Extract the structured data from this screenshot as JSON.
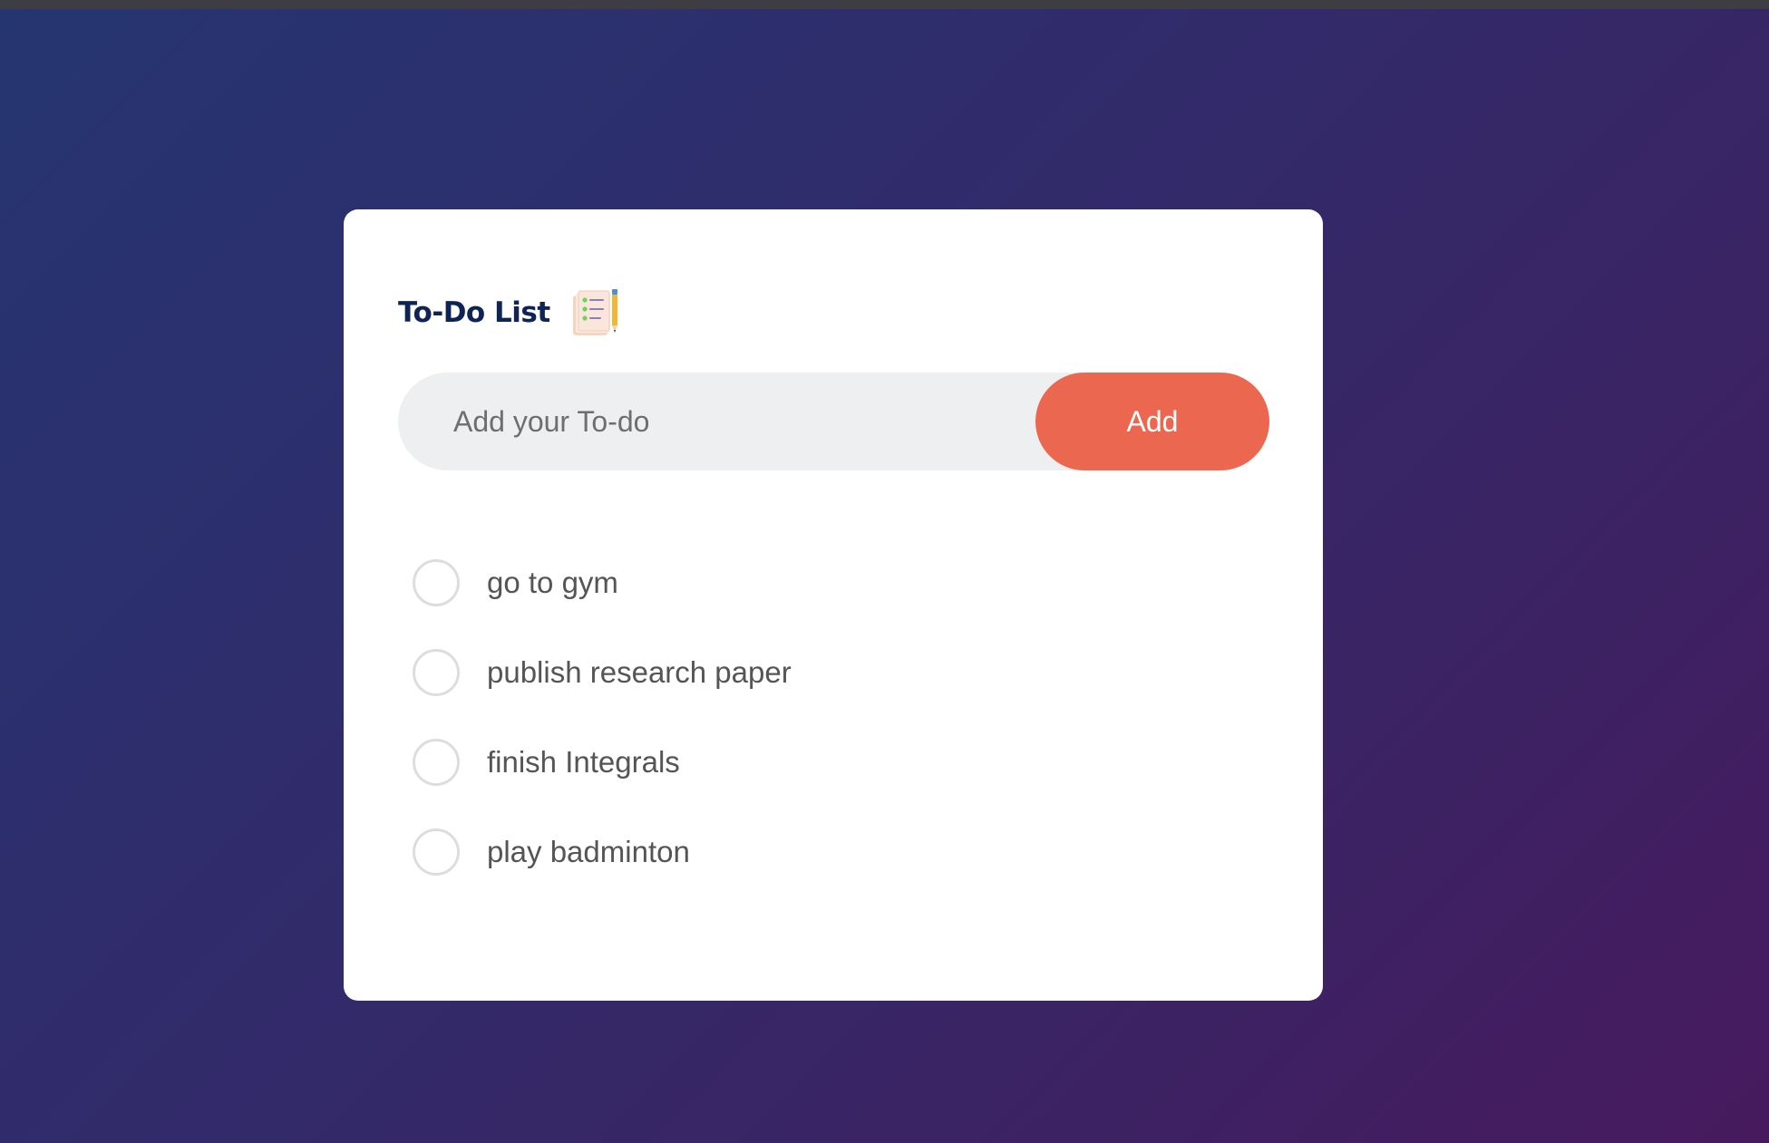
{
  "app": {
    "title": "To-Do List",
    "title_icon": "checklist-notepad-pencil-icon"
  },
  "input": {
    "placeholder": "Add your To-do",
    "value": ""
  },
  "add_button": {
    "label": "Add"
  },
  "todos": [
    {
      "text": "go to gym",
      "checked": false
    },
    {
      "text": "publish research paper",
      "checked": false
    },
    {
      "text": "finish Integrals",
      "checked": false
    },
    {
      "text": "play badminton",
      "checked": false
    }
  ],
  "colors": {
    "accent": "#ec674f",
    "title": "#0e2455",
    "input_bg": "#eeeff0",
    "text": "#555555",
    "circle_border": "#dddddd",
    "bg_gradient_start": "#253570",
    "bg_gradient_end": "#471a5e"
  }
}
